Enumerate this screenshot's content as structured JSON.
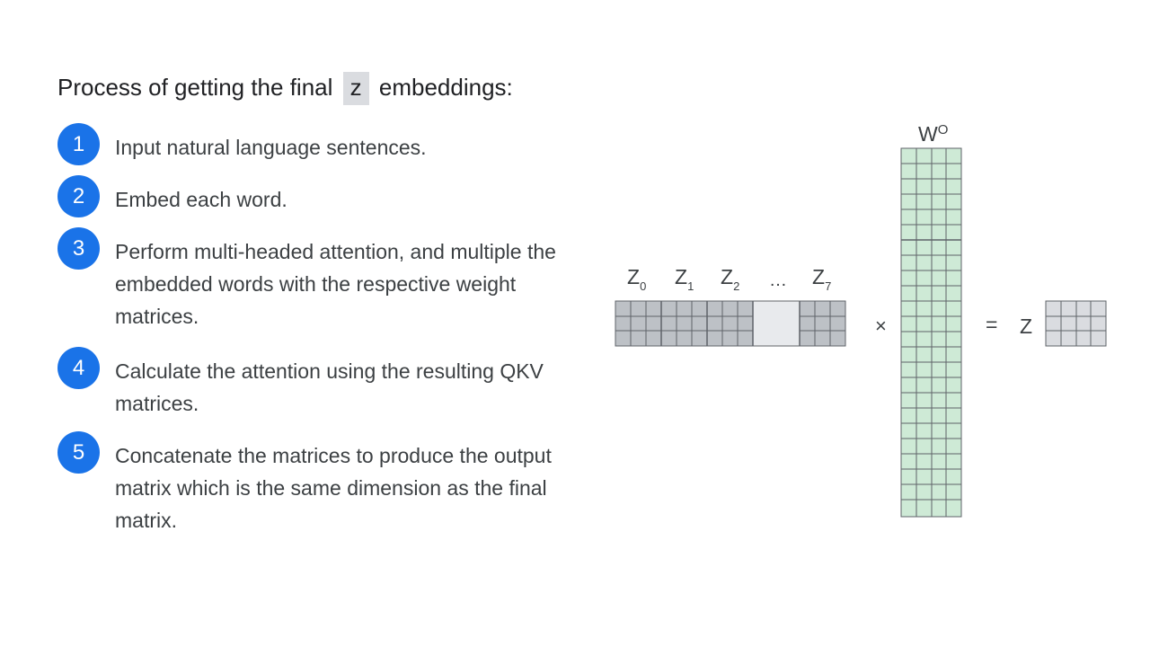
{
  "title": {
    "before": "Process of getting the final",
    "code": "z",
    "after": "embeddings:"
  },
  "steps": [
    {
      "num": "1",
      "text": "Input natural language sentences."
    },
    {
      "num": "2",
      "text": "Embed each word."
    },
    {
      "num": "3",
      "text": "Perform multi-headed attention, and multiple the embedded words with the respective weight matrices."
    },
    {
      "num": "4",
      "text": "Calculate the attention using the resulting QKV matrices."
    },
    {
      "num": "5",
      "text": "Concatenate the matrices to produce the output matrix which is the same dimension as the final matrix."
    }
  ],
  "diagram": {
    "z_labels": [
      {
        "base": "Z",
        "sub": "0"
      },
      {
        "base": "Z",
        "sub": "1"
      },
      {
        "base": "Z",
        "sub": "2"
      },
      {
        "base": "…",
        "sub": ""
      },
      {
        "base": "Z",
        "sub": "7"
      }
    ],
    "weight": {
      "base": "W",
      "sup": "O"
    },
    "times": "×",
    "equals": "=",
    "result": "Z",
    "colors": {
      "concat_fill": "#bdc1c6",
      "concat_faded": "#e8eaed",
      "weight_fill": "#ceead6",
      "result_fill": "#dadce0",
      "grid_line": "#5f6368",
      "badge": "#1a73e8"
    }
  }
}
